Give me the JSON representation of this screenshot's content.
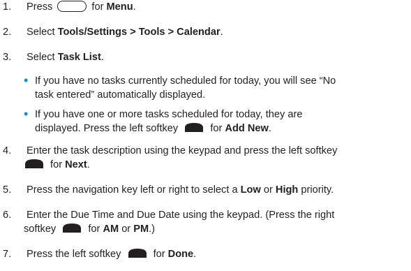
{
  "steps": [
    {
      "num": "1.",
      "a": "Press ",
      "b": " for ",
      "c": "Menu",
      "d": "."
    },
    {
      "num": "2.",
      "a": "Select ",
      "b": "Tools/Settings > Tools > Calendar",
      "c": "."
    },
    {
      "num": "3.",
      "a": "Select ",
      "b": "Task List",
      "c": "."
    },
    {
      "num": "4.",
      "line1": "Enter the task description using the keypad and press the left softkey",
      "line2_a": " for ",
      "line2_b": "Next",
      "line2_c": "."
    },
    {
      "num": "5.",
      "a": "Press the navigation key left or right to select a ",
      "b": "Low",
      "c": " or ",
      "d": "High",
      "e": " priority."
    },
    {
      "num": "6.",
      "line1": "Enter the Due Time and Due Date using the keypad. (Press the right",
      "line2_a": "softkey ",
      "line2_b": " for ",
      "line2_c": "AM",
      "line2_d": " or ",
      "line2_e": "PM",
      "line2_f": ".)"
    },
    {
      "num": "7.",
      "a": "Press the left softkey ",
      "b": " for ",
      "c": "Done",
      "d": "."
    }
  ],
  "bullets": [
    {
      "line1": "If you have no tasks currently scheduled for today, you will see “No",
      "line2": "task entered” automatically displayed."
    },
    {
      "line1": "If you have one or more tasks scheduled for today, they are",
      "line2_a": "displayed. Press the left softkey ",
      "line2_b": " for ",
      "line2_c": "Add New",
      "line2_d": "."
    }
  ],
  "bullet_symbol": "•",
  "colors": {
    "text": "#231f20",
    "bullet": "#0096d6"
  },
  "icons": {
    "menu_key": "oval-key-icon",
    "softkey": "softkey-icon"
  }
}
